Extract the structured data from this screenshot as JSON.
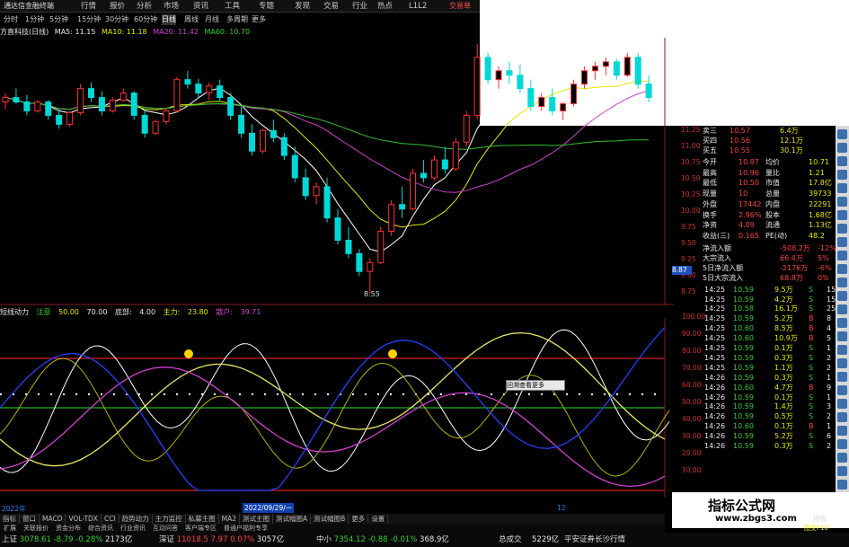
{
  "titlebar": {
    "app_title": "通达信金融终端",
    "account_label": "交易单"
  },
  "menu": [
    "行情",
    "报价",
    "分析",
    "市场",
    "资讯",
    "工具",
    "专题",
    "发现",
    "交易",
    "行业",
    "热点",
    "L1L2"
  ],
  "timeframes": [
    "分时",
    "1分钟",
    "5分钟",
    "15分钟",
    "30分钟",
    "60分钟",
    "日线",
    "周线",
    "月线",
    "多周期",
    "更多"
  ],
  "selected_timeframe": "日线",
  "ma_bar": {
    "stock": "方直科技(日线)",
    "ma5": "MA5: 11.15",
    "ma10": "MA10: 11.18",
    "ma20": "MA20: 11.42",
    "ma60": "MA60: 10.70"
  },
  "price_axis": [
    "11.25",
    "11.00",
    "10.75",
    "10.50",
    "10.25",
    "10.00",
    "9.75",
    "9.50",
    "9.25",
    "9.00",
    "8.75"
  ],
  "price_axis_highlight": "8.87",
  "low_marker": "8.55",
  "indicator_bar": {
    "name": "短线动力",
    "retail_label": "注意",
    "v1": "50.00",
    "v2": "70.00",
    "top_label": "底部:",
    "v3": "4.00",
    "bottom_label": "主力:",
    "v4": "23.80",
    "sell_label": "散户:",
    "v5": "39.71"
  },
  "ind_axis": [
    "100.00",
    "90.00",
    "80.00",
    "70.00",
    "60.00",
    "50.00",
    "40.00",
    "30.00",
    "20.00",
    "10.00"
  ],
  "date_labels": {
    "d1": "2022年",
    "d2": "2022/09/29/一",
    "m12": "12"
  },
  "popup_text": "回溯查看更多",
  "quote_panel": [
    {
      "label": "卖三",
      "price": "10.57",
      "vol": "6.4万"
    },
    {
      "label": "买四",
      "price": "10.56",
      "vol": "12.1万"
    },
    {
      "label": "买五",
      "price": "10.55",
      "vol": "30.1万"
    }
  ],
  "stats": [
    {
      "l1": "今开",
      "v1": "10.87",
      "l2": "均价",
      "v2": "10.71"
    },
    {
      "l1": "最高",
      "v1": "10.96",
      "l2": "量比",
      "v2": "1.21"
    },
    {
      "l1": "最低",
      "v1": "10.50",
      "l2": "市值",
      "v2": "17.8亿"
    },
    {
      "l1": "现量",
      "v1": "10",
      "l2": "总量",
      "v2": "39733"
    },
    {
      "l1": "外盘",
      "v1": "17442",
      "l2": "内盘",
      "v2": "22291"
    },
    {
      "l1": "换手",
      "v1": "2.96%",
      "l2": "股本",
      "v2": "1.68亿"
    },
    {
      "l1": "净资",
      "v1": "4.09",
      "l2": "流通",
      "v2": "1.13亿"
    },
    {
      "l1": "收益(三)",
      "v1": "0.165",
      "l2": "PE(动)",
      "v2": "48.2"
    }
  ],
  "flow": [
    {
      "label": "净流入额",
      "value": "-508.2万",
      "extra": "-12%"
    },
    {
      "label": "大宗流入",
      "value": "66.4万",
      "extra": "5%"
    },
    {
      "label": "5日净流入额",
      "value": "-2176万",
      "extra": "-6%"
    },
    {
      "label": "5日大宗流入",
      "value": "68.8万",
      "extra": "0%"
    }
  ],
  "ticks": [
    {
      "t": "14:25",
      "p": "10.59",
      "v": "9.5万",
      "s": "S",
      "n": "15"
    },
    {
      "t": "14:25",
      "p": "10.59",
      "v": "4.2万",
      "s": "S",
      "n": "15"
    },
    {
      "t": "14:25",
      "p": "10.58",
      "v": "16.1万",
      "s": "S",
      "n": "25"
    },
    {
      "t": "14:25",
      "p": "10.59",
      "v": "5.2万",
      "s": "B",
      "n": "8"
    },
    {
      "t": "14:25",
      "p": "10.60",
      "v": "8.5万",
      "s": "B",
      "n": "4"
    },
    {
      "t": "14:25",
      "p": "10.60",
      "v": "10.9万",
      "s": "B",
      "n": "5"
    },
    {
      "t": "14:25",
      "p": "10.59",
      "v": "0.1万",
      "s": "S",
      "n": "1"
    },
    {
      "t": "14:25",
      "p": "10.59",
      "v": "0.3万",
      "s": "S",
      "n": "2"
    },
    {
      "t": "14:25",
      "p": "10.59",
      "v": "1.1万",
      "s": "S",
      "n": "2"
    },
    {
      "t": "14:26",
      "p": "10.59",
      "v": "0.3万",
      "s": "S",
      "n": "1"
    },
    {
      "t": "14:26",
      "p": "10.60",
      "v": "4.7万",
      "s": "B",
      "n": "9"
    },
    {
      "t": "14:26",
      "p": "10.59",
      "v": "0.1万",
      "s": "S",
      "n": "1"
    },
    {
      "t": "14:26",
      "p": "10.59",
      "v": "1.4万",
      "s": "S",
      "n": "3"
    },
    {
      "t": "14:26",
      "p": "10.59",
      "v": "0.5万",
      "s": "S",
      "n": "2"
    },
    {
      "t": "14:26",
      "p": "10.60",
      "v": "0.1万",
      "s": "B",
      "n": "1"
    },
    {
      "t": "14:26",
      "p": "10.59",
      "v": "5.2万",
      "s": "S",
      "n": "6"
    },
    {
      "t": "14:26",
      "p": "10.59",
      "v": "0.3万",
      "s": "S",
      "n": "2"
    }
  ],
  "bottom_tabs": [
    "指标",
    "窗口",
    "MACD",
    "VOL-TDX",
    "CCI",
    "趋势动力",
    "主力监控",
    "私募主图",
    "MA2",
    "测试主图",
    "测试幅图A",
    "测试幅图B",
    "更多",
    "设置"
  ],
  "statusbar": [
    {
      "label": "上证",
      "value": "3078.61",
      "chg": "-8.79",
      "pct": "-0.28%",
      "amt": "2173亿"
    },
    {
      "label": "深证",
      "value": "11018.5",
      "chg": "7.97",
      "pct": "0.07%",
      "amt": "3057亿"
    },
    {
      "label": "中小",
      "value": "7354.12",
      "chg": "-0.88",
      "pct": "-0.01%",
      "amt": "368.9亿"
    }
  ],
  "total_label": "总成交",
  "total_value": "5229亿",
  "broker": "平安证券长沙行情",
  "watermark": {
    "title": "指标公式网",
    "url": "www.zbgs3.com"
  },
  "extra_tabs": [
    "扩展",
    "关联报价",
    "资金分布",
    "综合资讯",
    "行业资讯",
    "互动问答",
    "客户端专区",
    "普通户福利专享"
  ],
  "side_label": "图交F10",
  "side_label2": "模板",
  "colors": {
    "up": "#ff3030",
    "down": "#00d8d8",
    "ma5": "#ffffff",
    "ma10": "#e8e800",
    "ma20": "#d040d0",
    "ma60": "#30c030"
  },
  "chart_data": {
    "type": "candlestick",
    "ylim": [
      8.5,
      11.4
    ],
    "candles": [
      [
        10.7,
        10.8,
        10.62,
        10.75
      ],
      [
        10.75,
        10.85,
        10.68,
        10.7
      ],
      [
        10.7,
        10.78,
        10.55,
        10.6
      ],
      [
        10.6,
        10.72,
        10.58,
        10.7
      ],
      [
        10.7,
        10.72,
        10.5,
        10.55
      ],
      [
        10.55,
        10.62,
        10.4,
        10.45
      ],
      [
        10.45,
        10.6,
        10.42,
        10.58
      ],
      [
        10.58,
        10.9,
        10.55,
        10.85
      ],
      [
        10.85,
        10.92,
        10.7,
        10.75
      ],
      [
        10.75,
        10.82,
        10.55,
        10.6
      ],
      [
        10.6,
        10.75,
        10.58,
        10.72
      ],
      [
        10.72,
        10.85,
        10.7,
        10.8
      ],
      [
        10.8,
        10.82,
        10.5,
        10.55
      ],
      [
        10.55,
        10.62,
        10.3,
        10.35
      ],
      [
        10.35,
        10.5,
        10.33,
        10.48
      ],
      [
        10.48,
        10.62,
        10.45,
        10.6
      ],
      [
        10.6,
        10.98,
        10.58,
        10.95
      ],
      [
        10.95,
        11.05,
        10.85,
        10.9
      ],
      [
        10.9,
        10.96,
        10.75,
        10.8
      ],
      [
        10.8,
        10.92,
        10.72,
        10.88
      ],
      [
        10.88,
        10.95,
        10.7,
        10.75
      ],
      [
        10.75,
        10.8,
        10.5,
        10.55
      ],
      [
        10.55,
        10.65,
        10.3,
        10.35
      ],
      [
        10.35,
        10.45,
        10.1,
        10.15
      ],
      [
        10.15,
        10.4,
        10.12,
        10.38
      ],
      [
        10.38,
        10.5,
        10.25,
        10.3
      ],
      [
        10.3,
        10.35,
        10.05,
        10.1
      ],
      [
        10.1,
        10.2,
        9.8,
        9.85
      ],
      [
        9.85,
        9.95,
        9.6,
        9.65
      ],
      [
        9.65,
        9.8,
        9.55,
        9.75
      ],
      [
        9.75,
        9.85,
        9.35,
        9.4
      ],
      [
        9.4,
        9.5,
        9.1,
        9.15
      ],
      [
        9.15,
        9.3,
        8.95,
        9.0
      ],
      [
        9.0,
        9.05,
        8.75,
        8.8
      ],
      [
        8.8,
        8.95,
        8.55,
        8.9
      ],
      [
        8.9,
        9.3,
        8.88,
        9.25
      ],
      [
        9.25,
        9.6,
        9.2,
        9.55
      ],
      [
        9.55,
        9.75,
        9.4,
        9.5
      ],
      [
        9.5,
        9.95,
        9.48,
        9.9
      ],
      [
        9.9,
        10.05,
        9.8,
        9.85
      ],
      [
        9.85,
        10.1,
        9.82,
        10.05
      ],
      [
        10.05,
        10.2,
        9.9,
        9.95
      ],
      [
        9.95,
        10.3,
        9.93,
        10.25
      ],
      [
        10.25,
        10.6,
        10.2,
        10.55
      ],
      [
        10.55,
        11.35,
        10.5,
        11.2
      ],
      [
        11.2,
        11.25,
        10.9,
        10.95
      ],
      [
        10.95,
        11.1,
        10.85,
        11.05
      ],
      [
        11.05,
        11.15,
        10.9,
        11.0
      ],
      [
        11.0,
        11.12,
        10.8,
        10.85
      ],
      [
        10.85,
        10.95,
        10.6,
        10.65
      ],
      [
        10.65,
        10.8,
        10.6,
        10.75
      ],
      [
        10.75,
        10.85,
        10.55,
        10.6
      ],
      [
        10.6,
        10.7,
        10.5,
        10.68
      ],
      [
        10.68,
        10.95,
        10.65,
        10.9
      ],
      [
        10.9,
        11.1,
        10.85,
        11.05
      ],
      [
        11.05,
        11.15,
        10.95,
        11.1
      ],
      [
        11.1,
        11.2,
        11.0,
        11.15
      ],
      [
        11.15,
        11.18,
        10.95,
        11.0
      ],
      [
        11.0,
        11.25,
        10.98,
        11.2
      ],
      [
        11.2,
        11.25,
        10.85,
        10.9
      ],
      [
        10.9,
        11.0,
        10.7,
        10.75
      ]
    ]
  }
}
